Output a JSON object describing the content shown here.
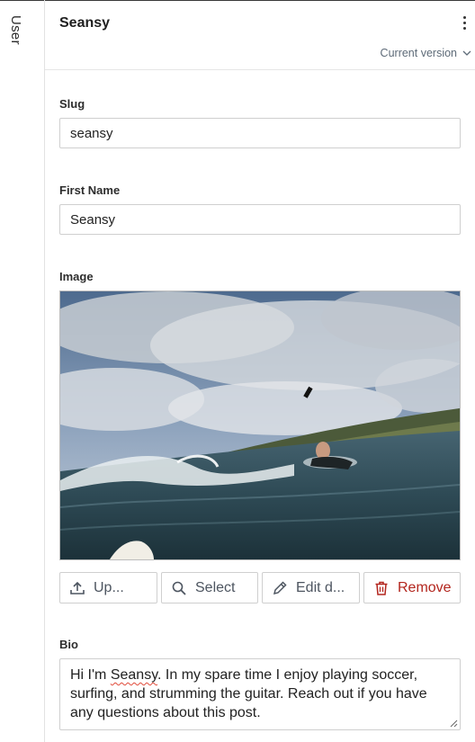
{
  "sidebar": {
    "tab_label": "User"
  },
  "header": {
    "title": "Seansy",
    "version_label": "Current version"
  },
  "fields": {
    "slug": {
      "label": "Slug",
      "value": "seansy"
    },
    "first_name": {
      "label": "First Name",
      "value": "Seansy"
    },
    "image": {
      "label": "Image",
      "actions": {
        "upload": "Up...",
        "select": "Select",
        "edit": "Edit d...",
        "remove": "Remove"
      }
    },
    "bio": {
      "label": "Bio",
      "text_before": "Hi I'm ",
      "misspelled_word": "Seansy",
      "text_after": ". In my spare time I enjoy playing soccer, surfing, and strumming the guitar.  Reach out if you have any questions about this post."
    }
  },
  "colors": {
    "danger": "#b3261e",
    "muted": "#5e6b78",
    "border": "#cfcfcf"
  }
}
